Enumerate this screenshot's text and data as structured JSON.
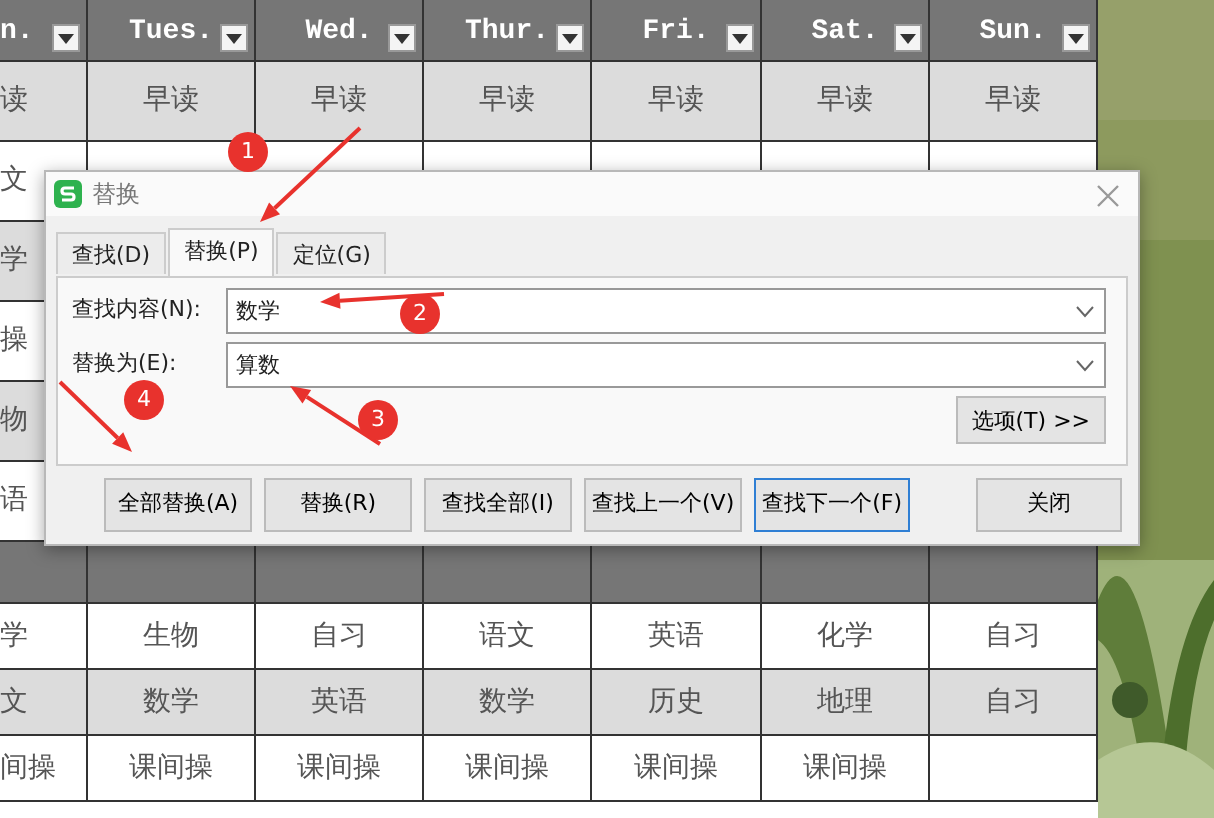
{
  "sheet": {
    "columns": [
      {
        "header": "n."
      },
      {
        "header": "Tues."
      },
      {
        "header": "Wed."
      },
      {
        "header": "Thur."
      },
      {
        "header": "Fri."
      },
      {
        "header": "Sat."
      },
      {
        "header": "Sun."
      }
    ],
    "rows": [
      {
        "kind": "shaded",
        "cells": [
          "读",
          "早读",
          "早读",
          "早读",
          "早读",
          "早读",
          "早读"
        ]
      },
      {
        "kind": "plain",
        "cells": [
          "文"
        ]
      },
      {
        "kind": "shaded",
        "cells": [
          "学"
        ]
      },
      {
        "kind": "plain",
        "cells": [
          "操"
        ]
      },
      {
        "kind": "shaded",
        "cells": [
          "物"
        ]
      },
      {
        "kind": "plain",
        "cells": [
          "语"
        ]
      },
      {
        "kind": "dark",
        "cells": []
      },
      {
        "kind": "plain",
        "cells": [
          "学",
          "生物",
          "自习",
          "语文",
          "英语",
          "化学",
          "自习"
        ]
      },
      {
        "kind": "shaded",
        "cells": [
          "文",
          "数学",
          "英语",
          "数学",
          "历史",
          "地理",
          "自习"
        ]
      },
      {
        "kind": "plain",
        "cells": [
          "间操",
          "课间操",
          "课间操",
          "课间操",
          "课间操",
          "课间操"
        ]
      }
    ]
  },
  "dialog": {
    "title": "替换",
    "tabs": [
      {
        "label": "查找(D)",
        "selected": false
      },
      {
        "label": "替换(P)",
        "selected": true
      },
      {
        "label": "定位(G)",
        "selected": false
      }
    ],
    "fields": [
      {
        "label": "查找内容(N):",
        "value": "数学"
      },
      {
        "label": "替换为(E):",
        "value": "算数"
      }
    ],
    "options_button": "选项(T) >>",
    "buttons": [
      {
        "label": "全部替换(A)",
        "focused": false
      },
      {
        "label": "替换(R)",
        "focused": false
      },
      {
        "label": "查找全部(I)",
        "focused": false
      },
      {
        "label": "查找上一个(V)",
        "focused": false
      },
      {
        "label": "查找下一个(F)",
        "focused": true
      },
      {
        "label": "关闭",
        "focused": false
      }
    ]
  },
  "annotations": [
    {
      "number": "1"
    },
    {
      "number": "2"
    },
    {
      "number": "3"
    },
    {
      "number": "4"
    }
  ]
}
